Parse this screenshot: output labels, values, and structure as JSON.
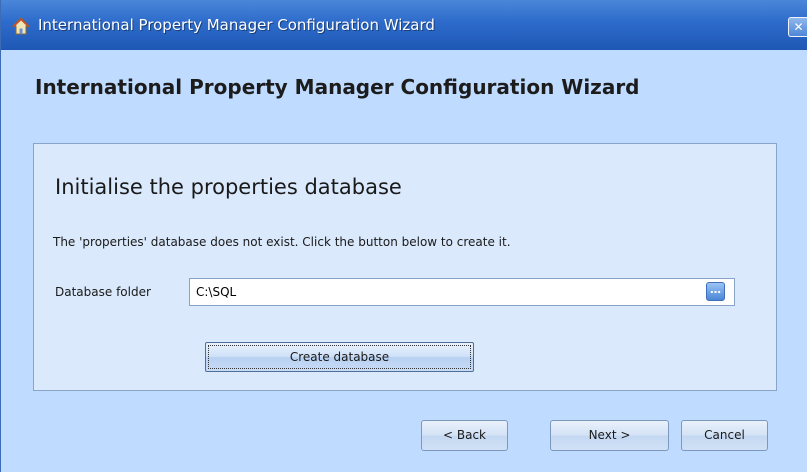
{
  "window": {
    "title": "International Property Manager Configuration Wizard",
    "close_glyph": "✕"
  },
  "wizard": {
    "heading": "International Property Manager Configuration Wizard"
  },
  "step": {
    "title": "Initialise the properties database",
    "description": "The 'properties' database does not exist.  Click the button below to create it.",
    "folder_label": "Database folder",
    "folder_value": "C:\\SQL",
    "browse_glyph": "…",
    "create_button_label": "Create database"
  },
  "navigation": {
    "back_label": "< Back",
    "next_label": "Next >",
    "cancel_label": "Cancel"
  },
  "icons": {
    "app": "house-icon",
    "close": "close-icon",
    "browse": "ellipsis-icon"
  },
  "colors": {
    "titlebar": "#2d6bcb",
    "window_background": "#bfdbff",
    "panel_background": "#dae9fc"
  }
}
